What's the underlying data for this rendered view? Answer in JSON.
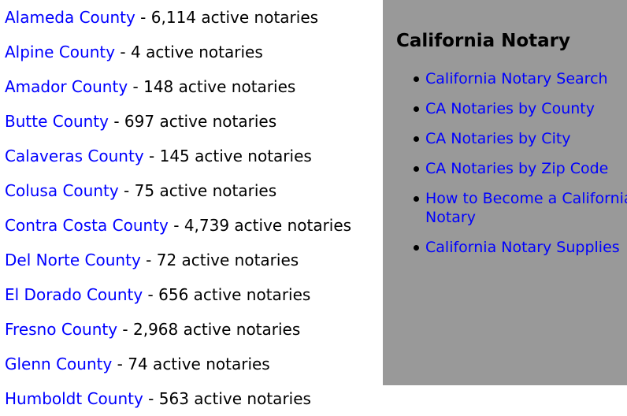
{
  "counties": [
    {
      "name": "Alameda County",
      "separator": " - ",
      "count": "6,114 active notaries"
    },
    {
      "name": "Alpine County",
      "separator": " - ",
      "count": "4 active notaries"
    },
    {
      "name": "Amador County",
      "separator": " - ",
      "count": "148 active notaries"
    },
    {
      "name": "Butte County",
      "separator": " - ",
      "count": "697 active notaries"
    },
    {
      "name": "Calaveras County",
      "separator": " - ",
      "count": "145 active notaries"
    },
    {
      "name": "Colusa County",
      "separator": " - ",
      "count": "75 active notaries"
    },
    {
      "name": "Contra Costa County",
      "separator": " - ",
      "count": "4,739 active notaries"
    },
    {
      "name": "Del Norte County",
      "separator": " - ",
      "count": "72 active notaries"
    },
    {
      "name": "El Dorado County",
      "separator": " - ",
      "count": "656 active notaries"
    },
    {
      "name": "Fresno County",
      "separator": " - ",
      "count": "2,968 active notaries"
    },
    {
      "name": "Glenn County",
      "separator": " - ",
      "count": "74 active notaries"
    },
    {
      "name": "Humboldt County",
      "separator": " - ",
      "count": "563 active notaries"
    }
  ],
  "sidebar": {
    "title": "California Notary",
    "links": [
      {
        "label": "California Notary Search"
      },
      {
        "label": "CA Notaries by County"
      },
      {
        "label": "CA Notaries by City"
      },
      {
        "label": "CA Notaries by Zip Code"
      },
      {
        "label": "How to Become a California Notary"
      },
      {
        "label": "California Notary Supplies"
      }
    ]
  },
  "colors": {
    "link": "#0000ff",
    "text": "#000000",
    "sidebar_background": "#999999",
    "page_background": "#ffffff"
  }
}
